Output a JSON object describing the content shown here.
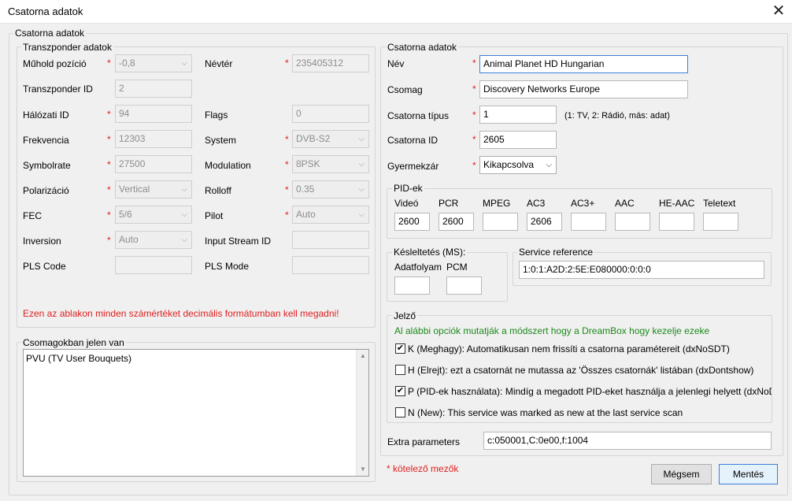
{
  "window": {
    "title": "Csatorna adatok",
    "close_glyph": "✕"
  },
  "main_group": {
    "legend": "Csatorna adatok"
  },
  "transponder": {
    "legend": "Transzponder adatok",
    "orbital_position": {
      "label": "Műhold pozíció",
      "value": "-0,8"
    },
    "namespace": {
      "label": "Névtér",
      "value": "235405312"
    },
    "transponder_id": {
      "label": "Transzponder ID",
      "value": "2"
    },
    "network_id": {
      "label": "Hálózati ID",
      "value": "94"
    },
    "flags": {
      "label": "Flags",
      "value": "0"
    },
    "frequency": {
      "label": "Frekvencia",
      "value": "12303"
    },
    "system": {
      "label": "System",
      "value": "DVB-S2"
    },
    "symbolrate": {
      "label": "Symbolrate",
      "value": "27500"
    },
    "modulation": {
      "label": "Modulation",
      "value": "8PSK"
    },
    "polarization": {
      "label": "Polarizáció",
      "value": "Vertical"
    },
    "rolloff": {
      "label": "Rolloff",
      "value": "0.35"
    },
    "fec": {
      "label": "FEC",
      "value": "5/6"
    },
    "pilot": {
      "label": "Pilot",
      "value": "Auto"
    },
    "inversion": {
      "label": "Inversion",
      "value": "Auto"
    },
    "input_stream_id": {
      "label": "Input Stream ID",
      "value": ""
    },
    "pls_code": {
      "label": "PLS Code",
      "value": ""
    },
    "pls_mode": {
      "label": "PLS Mode",
      "value": ""
    },
    "warning": "Ezen az ablakon minden számértéket decimális formátumban kell megadni!"
  },
  "bouquets": {
    "legend": "Csomagokban jelen van",
    "items": [
      "PVU (TV User Bouquets)"
    ]
  },
  "channel": {
    "legend": "Csatorna adatok",
    "name": {
      "label": "Név",
      "value": "Animal Planet HD Hungarian"
    },
    "package": {
      "label": "Csomag",
      "value": "Discovery Networks Europe"
    },
    "type": {
      "label": "Csatorna típus",
      "value": "1",
      "hint": "(1: TV, 2: Rádió, más: adat)"
    },
    "channel_id": {
      "label": "Csatorna ID",
      "value": "2605"
    },
    "parental": {
      "label": "Gyermekzár",
      "value": "Kikapcsolva"
    }
  },
  "pids": {
    "legend": "PID-ek",
    "columns": [
      {
        "label": "Videó",
        "value": "2600"
      },
      {
        "label": "PCR",
        "value": "2600"
      },
      {
        "label": "MPEG",
        "value": ""
      },
      {
        "label": "AC3",
        "value": "2606"
      },
      {
        "label": "AC3+",
        "value": ""
      },
      {
        "label": "AAC",
        "value": ""
      },
      {
        "label": "HE-AAC",
        "value": ""
      },
      {
        "label": "Teletext",
        "value": ""
      }
    ]
  },
  "delay": {
    "legend": "Késleltetés (MS):",
    "adatfolyam": {
      "label": "Adatfolyam",
      "value": ""
    },
    "pcm": {
      "label": "PCM",
      "value": ""
    }
  },
  "service_reference": {
    "legend": "Service reference",
    "value": "1:0:1:A2D:2:5E:E080000:0:0:0"
  },
  "flags_group": {
    "legend": "Jelző",
    "info": "Al alábbi opciók mutatják a módszert hogy a DreamBox hogy kezelje ezeke",
    "options": [
      {
        "checked": true,
        "label": "K (Meghagy): Automatikusan nem frissíti a csatorna paramétereit (dxNoSDT)"
      },
      {
        "checked": false,
        "label": "H (Elrejt): ezt a csatornát ne mutassa az 'Összes csatornák' listában (dxDontshow)"
      },
      {
        "checked": true,
        "label": "P (PID-ek használata): Mindíg a megadott PID-eket használja a jelenlegi helyett (dxNoDVB)"
      },
      {
        "checked": false,
        "label": "N (New): This service was marked as new at the last service scan"
      }
    ],
    "check_glyph": "✔"
  },
  "extra": {
    "label": "Extra parameters",
    "value": "c:050001,C:0e00,f:1004"
  },
  "required_note": "* kötelező mezők",
  "required_mark": "*",
  "buttons": {
    "cancel": "Mégsem",
    "save": "Mentés"
  },
  "colors": {
    "required": "#e02020",
    "info": "#1a8a1a",
    "focus": "#3c7fd6"
  }
}
